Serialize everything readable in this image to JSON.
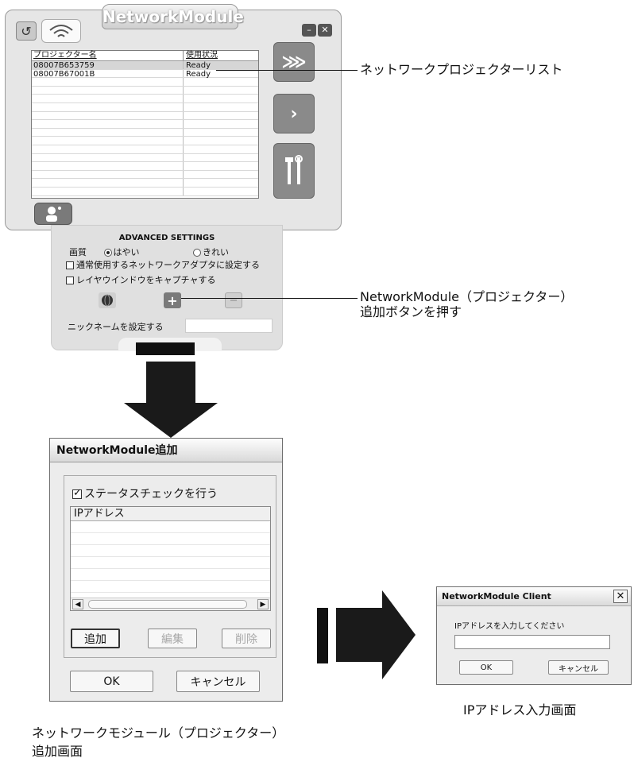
{
  "colors": {
    "accent": "#7f7f7f",
    "button_disabled": "#a8a8a8",
    "arrow": "#1a1a1a"
  },
  "main_window": {
    "title": "NetworkModule",
    "list": {
      "headers": [
        "プロジェクター名",
        "使用状況"
      ],
      "rows": [
        [
          "08007B653759",
          "Ready"
        ],
        [
          "08007B67001B",
          "Ready"
        ]
      ],
      "empty_rows": 14
    },
    "icons": {
      "refresh": "refresh-icon",
      "wifi": "wifi-icon",
      "play_all": "triple-chevron-icon",
      "play": "chevron-right-icon",
      "tools": "tools-icon",
      "user": "user-icon"
    },
    "win_buttons": [
      "–",
      "✕"
    ]
  },
  "advanced": {
    "title": "ADVANCED SETTINGS",
    "quality_label": "画質",
    "quality_options": [
      {
        "label": "はやい",
        "selected": true
      },
      {
        "label": "きれい",
        "selected": false
      }
    ],
    "checkbox1": "通常使用するネットワークアダプタに設定する",
    "checkbox2": "レイヤウインドウをキャプチャする",
    "nickname_label": "ニックネームを設定する",
    "add_button_glyph": "+"
  },
  "callouts": {
    "list": "ネットワークプロジェクターリスト",
    "add_line1": "NetworkModule（プロジェクター）",
    "add_line2": "追加ボタンを押す"
  },
  "add_dialog": {
    "title": "NetworkModule追加",
    "status_check": "ステータスチェックを行う",
    "column": "IPアドレス",
    "add": "追加",
    "edit": "編集",
    "delete": "削除",
    "ok": "OK",
    "cancel": "キャンセル",
    "caption_line1": "ネットワークモジュール（プロジェクター）",
    "caption_line2": "追加画面"
  },
  "client_dialog": {
    "title": "NetworkModule Client",
    "prompt": "IPアドレスを入力してください",
    "ok": "OK",
    "cancel": "キャンセル",
    "caption": "IPアドレス入力画面"
  }
}
